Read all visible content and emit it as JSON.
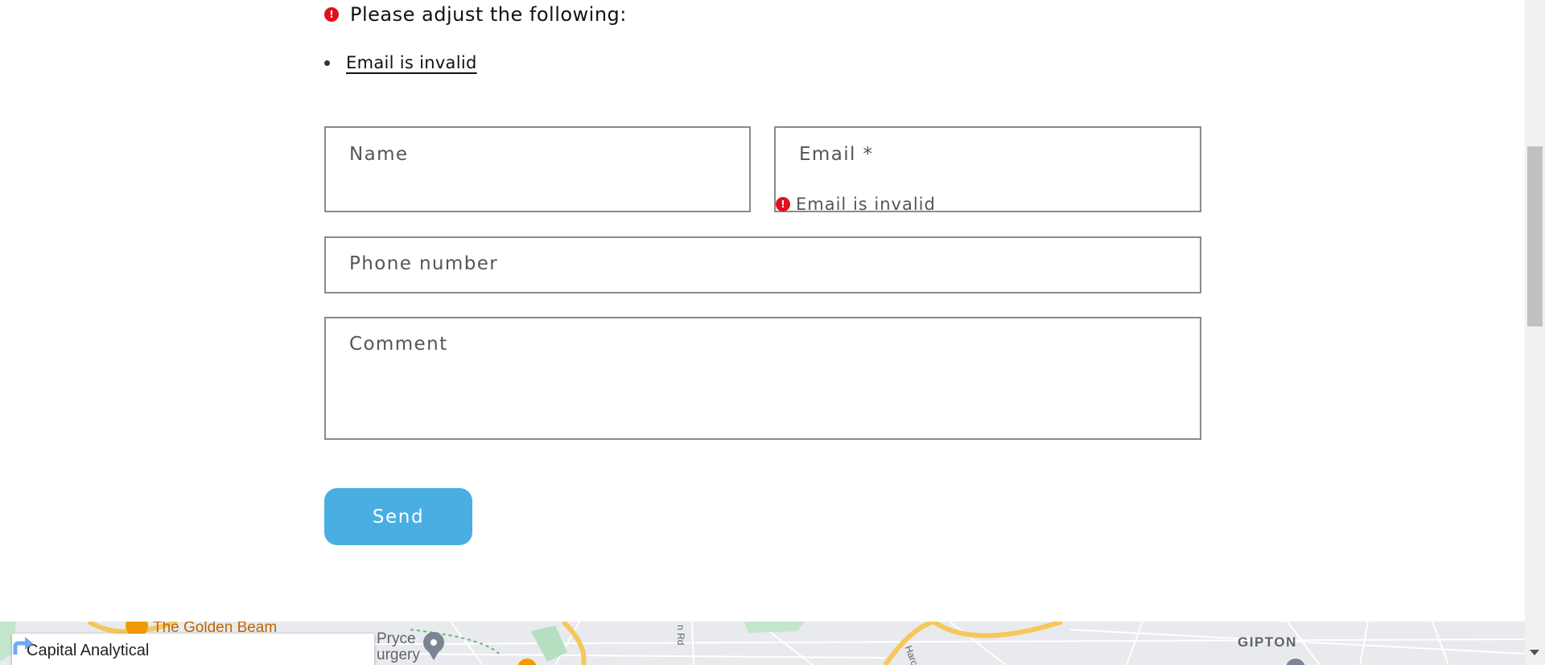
{
  "error_summary": {
    "heading": "Please adjust the following:",
    "items": [
      "Email is invalid"
    ]
  },
  "form": {
    "name_label": "Name",
    "email_label": "Email *",
    "email_error": "Email is invalid",
    "phone_label": "Phone number",
    "comment_label": "Comment",
    "send_label": "Send"
  },
  "map": {
    "card_title": "Capital Analytical",
    "labels": {
      "golden_beam": "The Golden Beam",
      "pryce_line1": "Pryce",
      "pryce_line2": "urgery",
      "gipton": "GIPTON",
      "rd": "n Rd",
      "harc": "Harc"
    }
  },
  "colors": {
    "accent": "#49aee1",
    "error": "#e0101c",
    "field_border": "#8a8a8a"
  },
  "icons": {
    "error": "exclamation-circle-icon",
    "directions": "directions-arrow-icon",
    "map_pin": "map-pin-icon",
    "restaurant": "fork-knife-icon"
  }
}
